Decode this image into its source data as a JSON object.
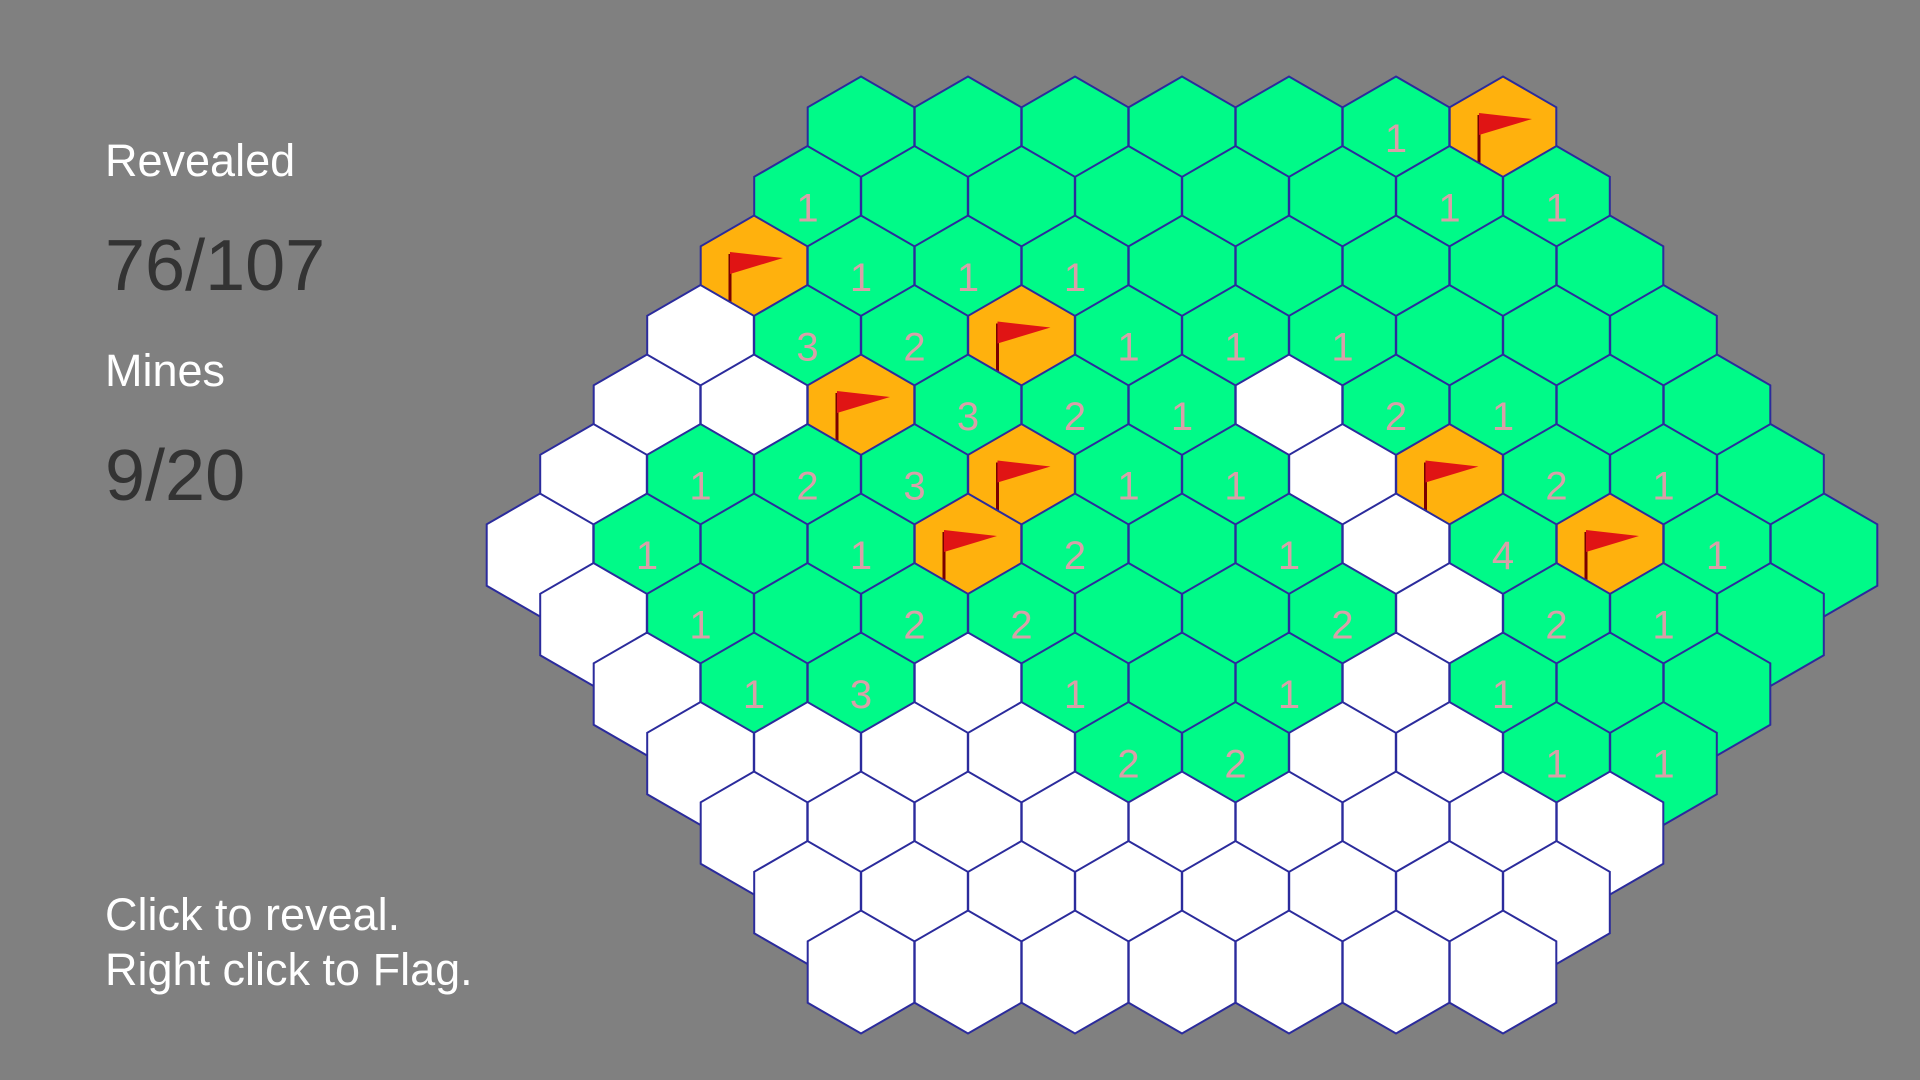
{
  "stats": {
    "revealed_label": "Revealed",
    "revealed_value": "76/107",
    "mines_label": "Mines",
    "mines_value": "9/20"
  },
  "instructions": [
    "Click to reveal.",
    "Right click to Flag."
  ],
  "colors": {
    "background": "#808080",
    "revealed": "#00FA88",
    "hidden": "#FFFFFF",
    "flagged": "#FFB10D",
    "number": "#D8A0A8",
    "flag": "#E01414",
    "border": "#2B2B9C"
  },
  "board": {
    "radius": 6,
    "rows": [
      "R R R R R 1 F",
      "1 R R R R R 1 1",
      "F 1 1 1 R R R R R",
      "H 3 2 F 1 1 1 R R R",
      "H H F 3 2 1 H 2 1 R R",
      "H 1 2 3 F 1 1 H F 2 1 R",
      "H 1 R 1 F 2 R 1 H 4 F 1 R",
      "H 1 R 2 2 R R 2 H 2 1 R",
      "H 1 3 H 1 R 1 H 1 R R",
      "H H H H 2 2 H H 1 1",
      "H H H H H H H H H",
      "H H H H H H H H",
      "H H H H H H H"
    ]
  }
}
